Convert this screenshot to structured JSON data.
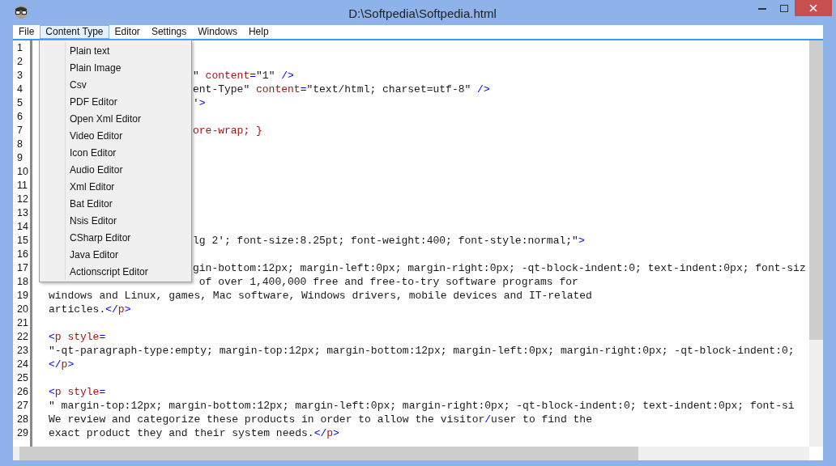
{
  "window": {
    "title": "D:\\Softpedia\\Softpedia.html"
  },
  "menu": [
    {
      "label": "File",
      "selected": false
    },
    {
      "label": "Content Type",
      "selected": true
    },
    {
      "label": "Editor",
      "selected": false
    },
    {
      "label": "Settings",
      "selected": false
    },
    {
      "label": "Windows",
      "selected": false
    },
    {
      "label": "Help",
      "selected": false
    }
  ],
  "dropdown": {
    "items": [
      "Plain text",
      "Plain Image",
      "Csv",
      "PDF Editor",
      "Open Xml Editor",
      "Video Editor",
      "Icon Editor",
      "Audio Editor",
      "Xml Editor",
      "Bat Editor",
      "Nsis Editor",
      "CSharp Editor",
      "Java Editor",
      "Actionscript Editor"
    ]
  },
  "editor": {
    "lines": [
      {
        "number": "1",
        "kind": "after_menu"
      },
      {
        "number": "2",
        "kind": "after_menu"
      },
      {
        "number": "3",
        "kind": "after_menu",
        "segments": [
          {
            "kind": "text",
            "text": "\""
          },
          {
            "kind": "name",
            "text": " content"
          },
          {
            "kind": "tag",
            "text": "="
          },
          {
            "kind": "text",
            "text": "\"1\""
          },
          {
            "kind": "tag",
            "text": " />"
          }
        ]
      },
      {
        "number": "4",
        "kind": "after_menu",
        "segments": [
          {
            "kind": "text",
            "text": "ent-Type\""
          },
          {
            "kind": "name",
            "text": " content"
          },
          {
            "kind": "tag",
            "text": "="
          },
          {
            "kind": "text",
            "text": "\"text/html; charset=utf-8\""
          },
          {
            "kind": "tag",
            "text": " />"
          }
        ]
      },
      {
        "number": "5",
        "kind": "after_menu",
        "segments": [
          {
            "kind": "text",
            "text": "'"
          },
          {
            "kind": "tag",
            "text": ">"
          }
        ]
      },
      {
        "number": "6",
        "kind": "after_menu"
      },
      {
        "number": "7",
        "kind": "after_menu",
        "segments": [
          {
            "kind": "name",
            "text": "ore-wrap; }"
          }
        ]
      },
      {
        "number": "8",
        "kind": "after_menu"
      },
      {
        "number": "9",
        "kind": "after_menu"
      },
      {
        "number": "10",
        "kind": "after_menu"
      },
      {
        "number": "11",
        "kind": "after_menu"
      },
      {
        "number": "12",
        "kind": "after_menu"
      },
      {
        "number": "13",
        "kind": "after_menu"
      },
      {
        "number": "14",
        "kind": "after_menu"
      },
      {
        "number": "15",
        "kind": "after_menu",
        "segments": [
          {
            "kind": "text",
            "text": "lg 2'; font-size:8.25pt; font-weight:400; font-style:normal;\""
          },
          {
            "kind": "tag",
            "text": ">"
          }
        ]
      },
      {
        "number": "16",
        "kind": "after_menu"
      },
      {
        "number": "17",
        "kind": "after_menu",
        "segments": [
          {
            "kind": "text",
            "text": "gin-bottom:12px; margin-left:0px; margin-right:0px; -qt-block-indent:0; text-indent:0px; font-siz"
          }
        ]
      },
      {
        "number": "18",
        "kind": "after_menu",
        "segments": [
          {
            "kind": "text",
            "text": " of over 1,400,000 free and free-to-try software programs for"
          }
        ]
      },
      {
        "number": "19",
        "kind": "full",
        "segments": [
          {
            "kind": "text",
            "text": "windows and Linux, games, Mac software, Windows drivers, mobile devices and IT-related"
          }
        ]
      },
      {
        "number": "20",
        "kind": "full",
        "segments": [
          {
            "kind": "text",
            "text": "articles."
          },
          {
            "kind": "tag",
            "text": "</"
          },
          {
            "kind": "name",
            "text": "p"
          },
          {
            "kind": "tag",
            "text": ">"
          }
        ]
      },
      {
        "number": "21",
        "kind": "full"
      },
      {
        "number": "22",
        "kind": "full",
        "segments": [
          {
            "kind": "tag",
            "text": "<"
          },
          {
            "kind": "name",
            "text": "p style"
          },
          {
            "kind": "tag",
            "text": "="
          }
        ]
      },
      {
        "number": "23",
        "kind": "full",
        "segments": [
          {
            "kind": "text",
            "text": "\"-qt-paragraph-type:empty; margin-top:12px; margin-bottom:12px; margin-left:0px; margin-right:0px; -qt-block-indent:0;"
          }
        ]
      },
      {
        "number": "24",
        "kind": "full",
        "segments": [
          {
            "kind": "tag",
            "text": "</"
          },
          {
            "kind": "name",
            "text": "p"
          },
          {
            "kind": "tag",
            "text": ">"
          }
        ]
      },
      {
        "number": "25",
        "kind": "full"
      },
      {
        "number": "26",
        "kind": "full",
        "segments": [
          {
            "kind": "tag",
            "text": "<"
          },
          {
            "kind": "name",
            "text": "p style"
          },
          {
            "kind": "tag",
            "text": "="
          }
        ]
      },
      {
        "number": "27",
        "kind": "full",
        "segments": [
          {
            "kind": "text",
            "text": "\" margin-top:12px; margin-bottom:12px; margin-left:0px; margin-right:0px; -qt-block-indent:0; text-indent:0px; font-si"
          }
        ]
      },
      {
        "number": "28",
        "kind": "full",
        "segments": [
          {
            "kind": "text",
            "text": "We review and categorize these products in order to allow the visitor"
          },
          {
            "kind": "tag",
            "text": "/"
          },
          {
            "kind": "text",
            "text": "user to find the"
          }
        ]
      },
      {
        "number": "29",
        "kind": "full",
        "segments": [
          {
            "kind": "text",
            "text": "exact product they and their system needs."
          },
          {
            "kind": "tag",
            "text": "</"
          },
          {
            "kind": "name",
            "text": "p"
          },
          {
            "kind": "tag",
            "text": ">"
          }
        ]
      }
    ]
  }
}
